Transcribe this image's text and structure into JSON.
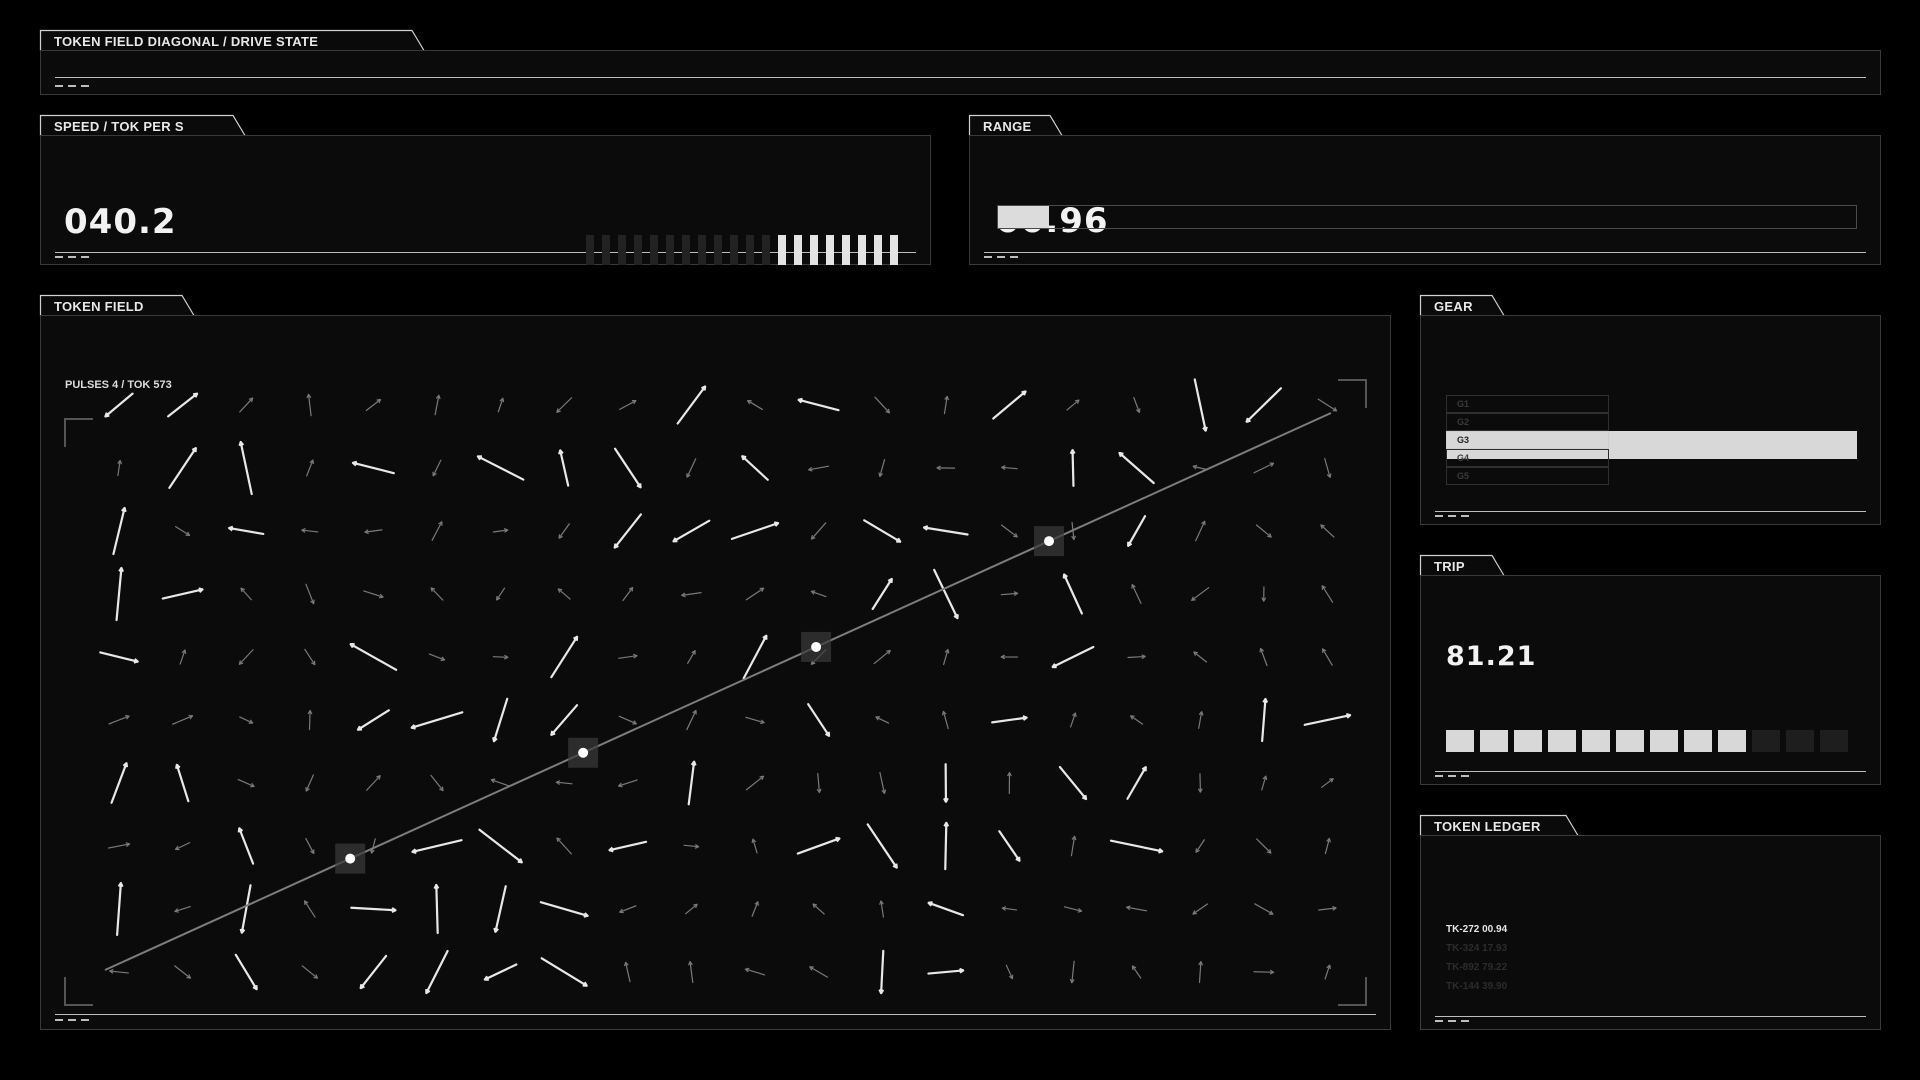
{
  "header": {
    "title": "TOKEN FIELD DIAGONAL / DRIVE STATE"
  },
  "speed": {
    "title": "SPEED / TOK PER S",
    "value": "040.2",
    "segments_total": 20,
    "segments_lit": 8
  },
  "range": {
    "title": "RANGE",
    "value": "00.96",
    "fraction": 0.06
  },
  "field": {
    "title": "TOKEN FIELD",
    "status": "PULSES 4 / TOK 573",
    "pulses": 4
  },
  "gear": {
    "title": "GEAR",
    "items": [
      "G1",
      "G2",
      "G3",
      "G4",
      "G5"
    ],
    "selected": "G3"
  },
  "trip": {
    "title": "TRIP",
    "value": "81.21",
    "segments_total": 12,
    "segments_lit": 9
  },
  "ledger": {
    "title": "TOKEN LEDGER",
    "rows": [
      {
        "id": "TK-272",
        "value": "00.94"
      },
      {
        "id": "TK-324",
        "value": "17.93"
      },
      {
        "id": "TK-892",
        "value": "79.22"
      },
      {
        "id": "TK-144",
        "value": "39.90"
      }
    ]
  },
  "colors": {
    "background": "#000000",
    "panel": "#0b0b0b",
    "accent": "#e6e6e6",
    "dim": "#2a2a2a"
  }
}
